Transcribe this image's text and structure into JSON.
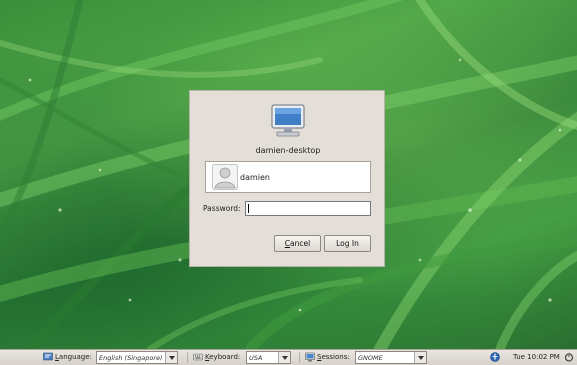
{
  "login": {
    "hostname": "damien-desktop",
    "user": "damien",
    "password_label": "Password:",
    "cancel_label": "Cancel",
    "login_label": "Log In",
    "cancel_mnemonic": "C",
    "cancel_rest": "ancel"
  },
  "panel": {
    "language_mnemonic": "L",
    "language_rest": "anguage:",
    "language_value": "English (Singapore)",
    "keyboard_mnemonic": "K",
    "keyboard_rest": "eyboard:",
    "keyboard_value": "USA",
    "sessions_mnemonic": "S",
    "sessions_rest": "essions:",
    "sessions_value": "GNOME",
    "clock": "Tue 10:02 PM"
  },
  "icons": {
    "computer": "computer-icon",
    "avatar": "user-avatar-icon",
    "language": "language-icon",
    "keyboard": "keyboard-icon",
    "sessions": "session-icon",
    "accessibility": "accessibility-icon",
    "power": "power-icon"
  },
  "colors": {
    "dialog_bg": "#e3ded7",
    "panel_bg": "#e0dcd5"
  }
}
